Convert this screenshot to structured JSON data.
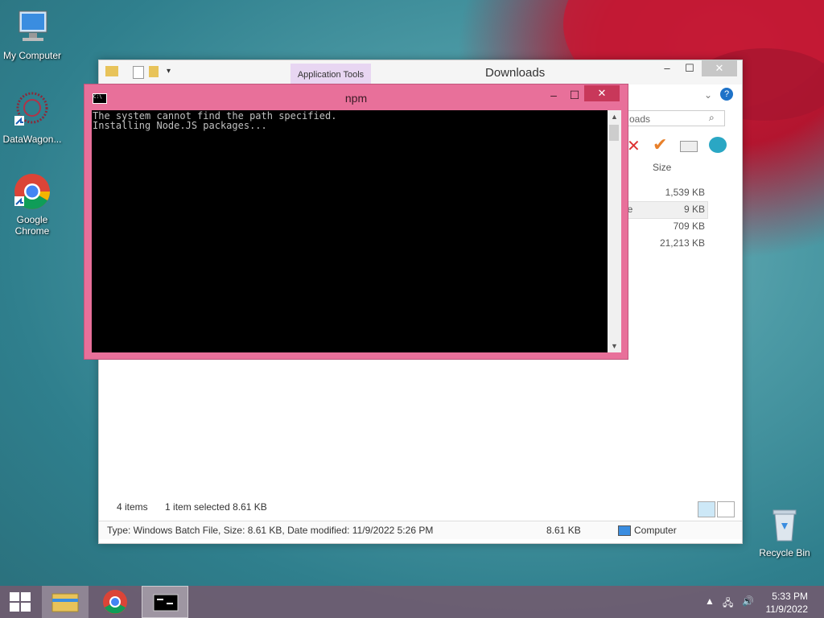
{
  "desktop": {
    "icons": [
      {
        "label": "My Computer"
      },
      {
        "label": "DataWagon..."
      },
      {
        "label": "Google Chrome"
      },
      {
        "label": "Recycle Bin"
      }
    ]
  },
  "explorer": {
    "title": "Downloads",
    "ribbon_tab": "Application Tools",
    "search_placeholder": "oads",
    "column_size": "Size",
    "rows": [
      {
        "size": "1,539 KB",
        "name_fragment": ""
      },
      {
        "size": "9 KB",
        "name_fragment": "le"
      },
      {
        "size": "709 KB",
        "name_fragment": ""
      },
      {
        "size": "21,213 KB",
        "name_fragment": ""
      }
    ],
    "status_items": "4 items",
    "status_selected": "1 item selected  8.61 KB",
    "details": "Type: Windows Batch File, Size: 8.61 KB, Date modified: 11/9/2022 5:26 PM",
    "details_size": "8.61 KB",
    "details_location": "Computer"
  },
  "cmd": {
    "title": "npm",
    "lines": "The system cannot find the path specified.\nInstalling Node.JS packages..."
  },
  "taskbar": {
    "time": "5:33 PM",
    "date": "11/9/2022"
  },
  "colors": {
    "cmd_frame": "#e8709a",
    "taskbar": "#735a6e"
  }
}
